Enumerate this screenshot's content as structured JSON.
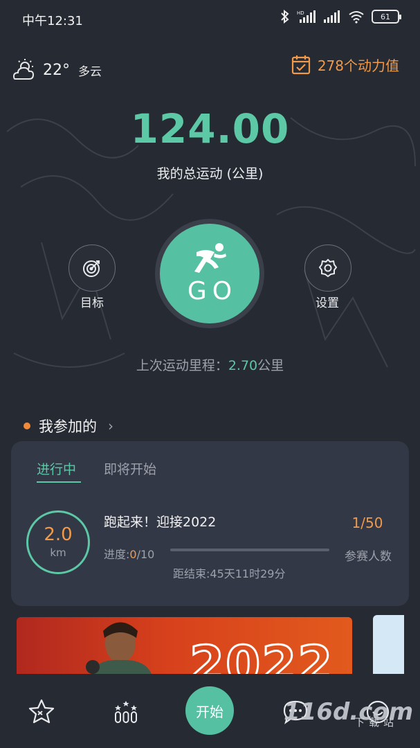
{
  "status_bar": {
    "time": "中午12:31",
    "battery": "61"
  },
  "weather": {
    "icon": "partly-cloudy-icon",
    "temperature": "22°",
    "description": "多云"
  },
  "energy": {
    "icon": "calendar-check-icon",
    "label": "278个动力值"
  },
  "summary": {
    "total_km": "124.00",
    "total_label": "我的总运动 (公里)"
  },
  "actions": {
    "goal_label": "目标",
    "go_label": "GO",
    "settings_label": "设置"
  },
  "last_run": {
    "prefix": "上次运动里程：",
    "value": "2.70",
    "unit": "公里"
  },
  "joined": {
    "title": "我参加的",
    "tabs": [
      "进行中",
      "即将开始"
    ],
    "event": {
      "distance": "2.0",
      "distance_unit": "km",
      "name": "跑起来！迎接2022",
      "progress_prefix": "进度:",
      "progress_current": "0",
      "progress_total": "/10",
      "progress_fraction": 0.0,
      "countdown": "距结束:45天11时29分",
      "participants": "1/50",
      "participants_label": "参赛人数"
    }
  },
  "banner": {
    "text": "2022"
  },
  "tabbar": {
    "start_label": "开始"
  },
  "watermark": {
    "main": "116d.com",
    "sub": "下载站"
  },
  "colors": {
    "accent": "#56c0a2",
    "orange": "#f09a4a",
    "background": "#262a33",
    "card": "#333846"
  }
}
